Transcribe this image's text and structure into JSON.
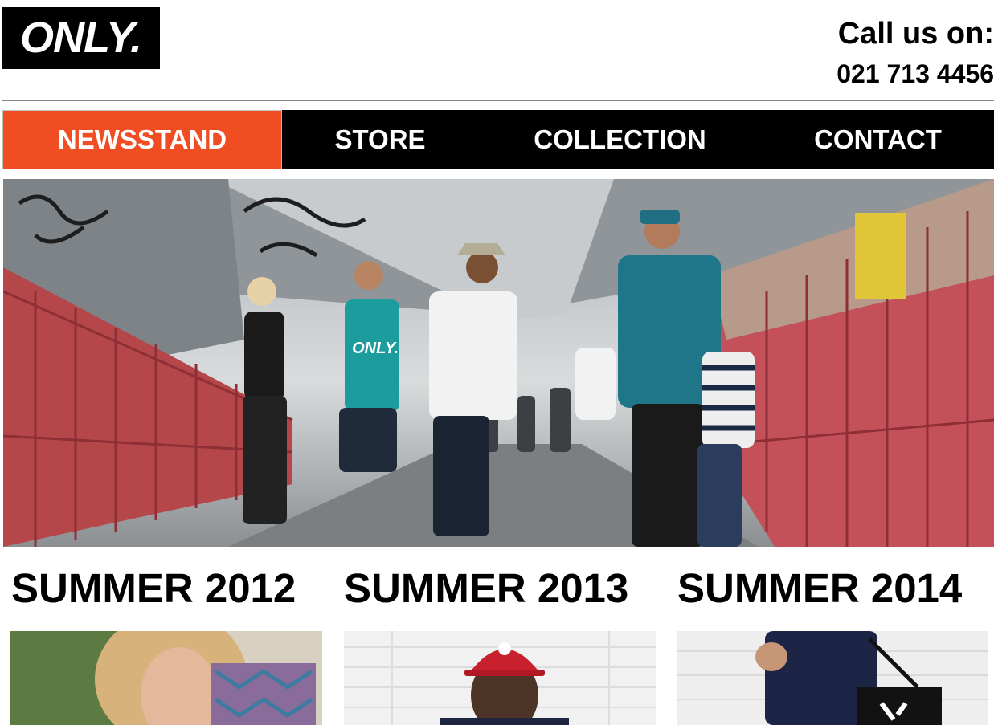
{
  "brand": {
    "logo_text": "ONLY."
  },
  "contact": {
    "label": "Call us on:",
    "phone": "021 713 4456"
  },
  "nav": {
    "items": [
      {
        "label": "NEWSSTAND",
        "active": true
      },
      {
        "label": "STORE",
        "active": false
      },
      {
        "label": "COLLECTION",
        "active": false
      },
      {
        "label": "CONTACT",
        "active": false
      }
    ]
  },
  "hero": {
    "shirt_text": "ONLY."
  },
  "collections": [
    {
      "title": "SUMMER 2012"
    },
    {
      "title": "SUMMER 2013"
    },
    {
      "title": "SUMMER 2014"
    }
  ],
  "colors": {
    "accent": "#f04d23",
    "nav_bg": "#000000",
    "text": "#000000"
  }
}
